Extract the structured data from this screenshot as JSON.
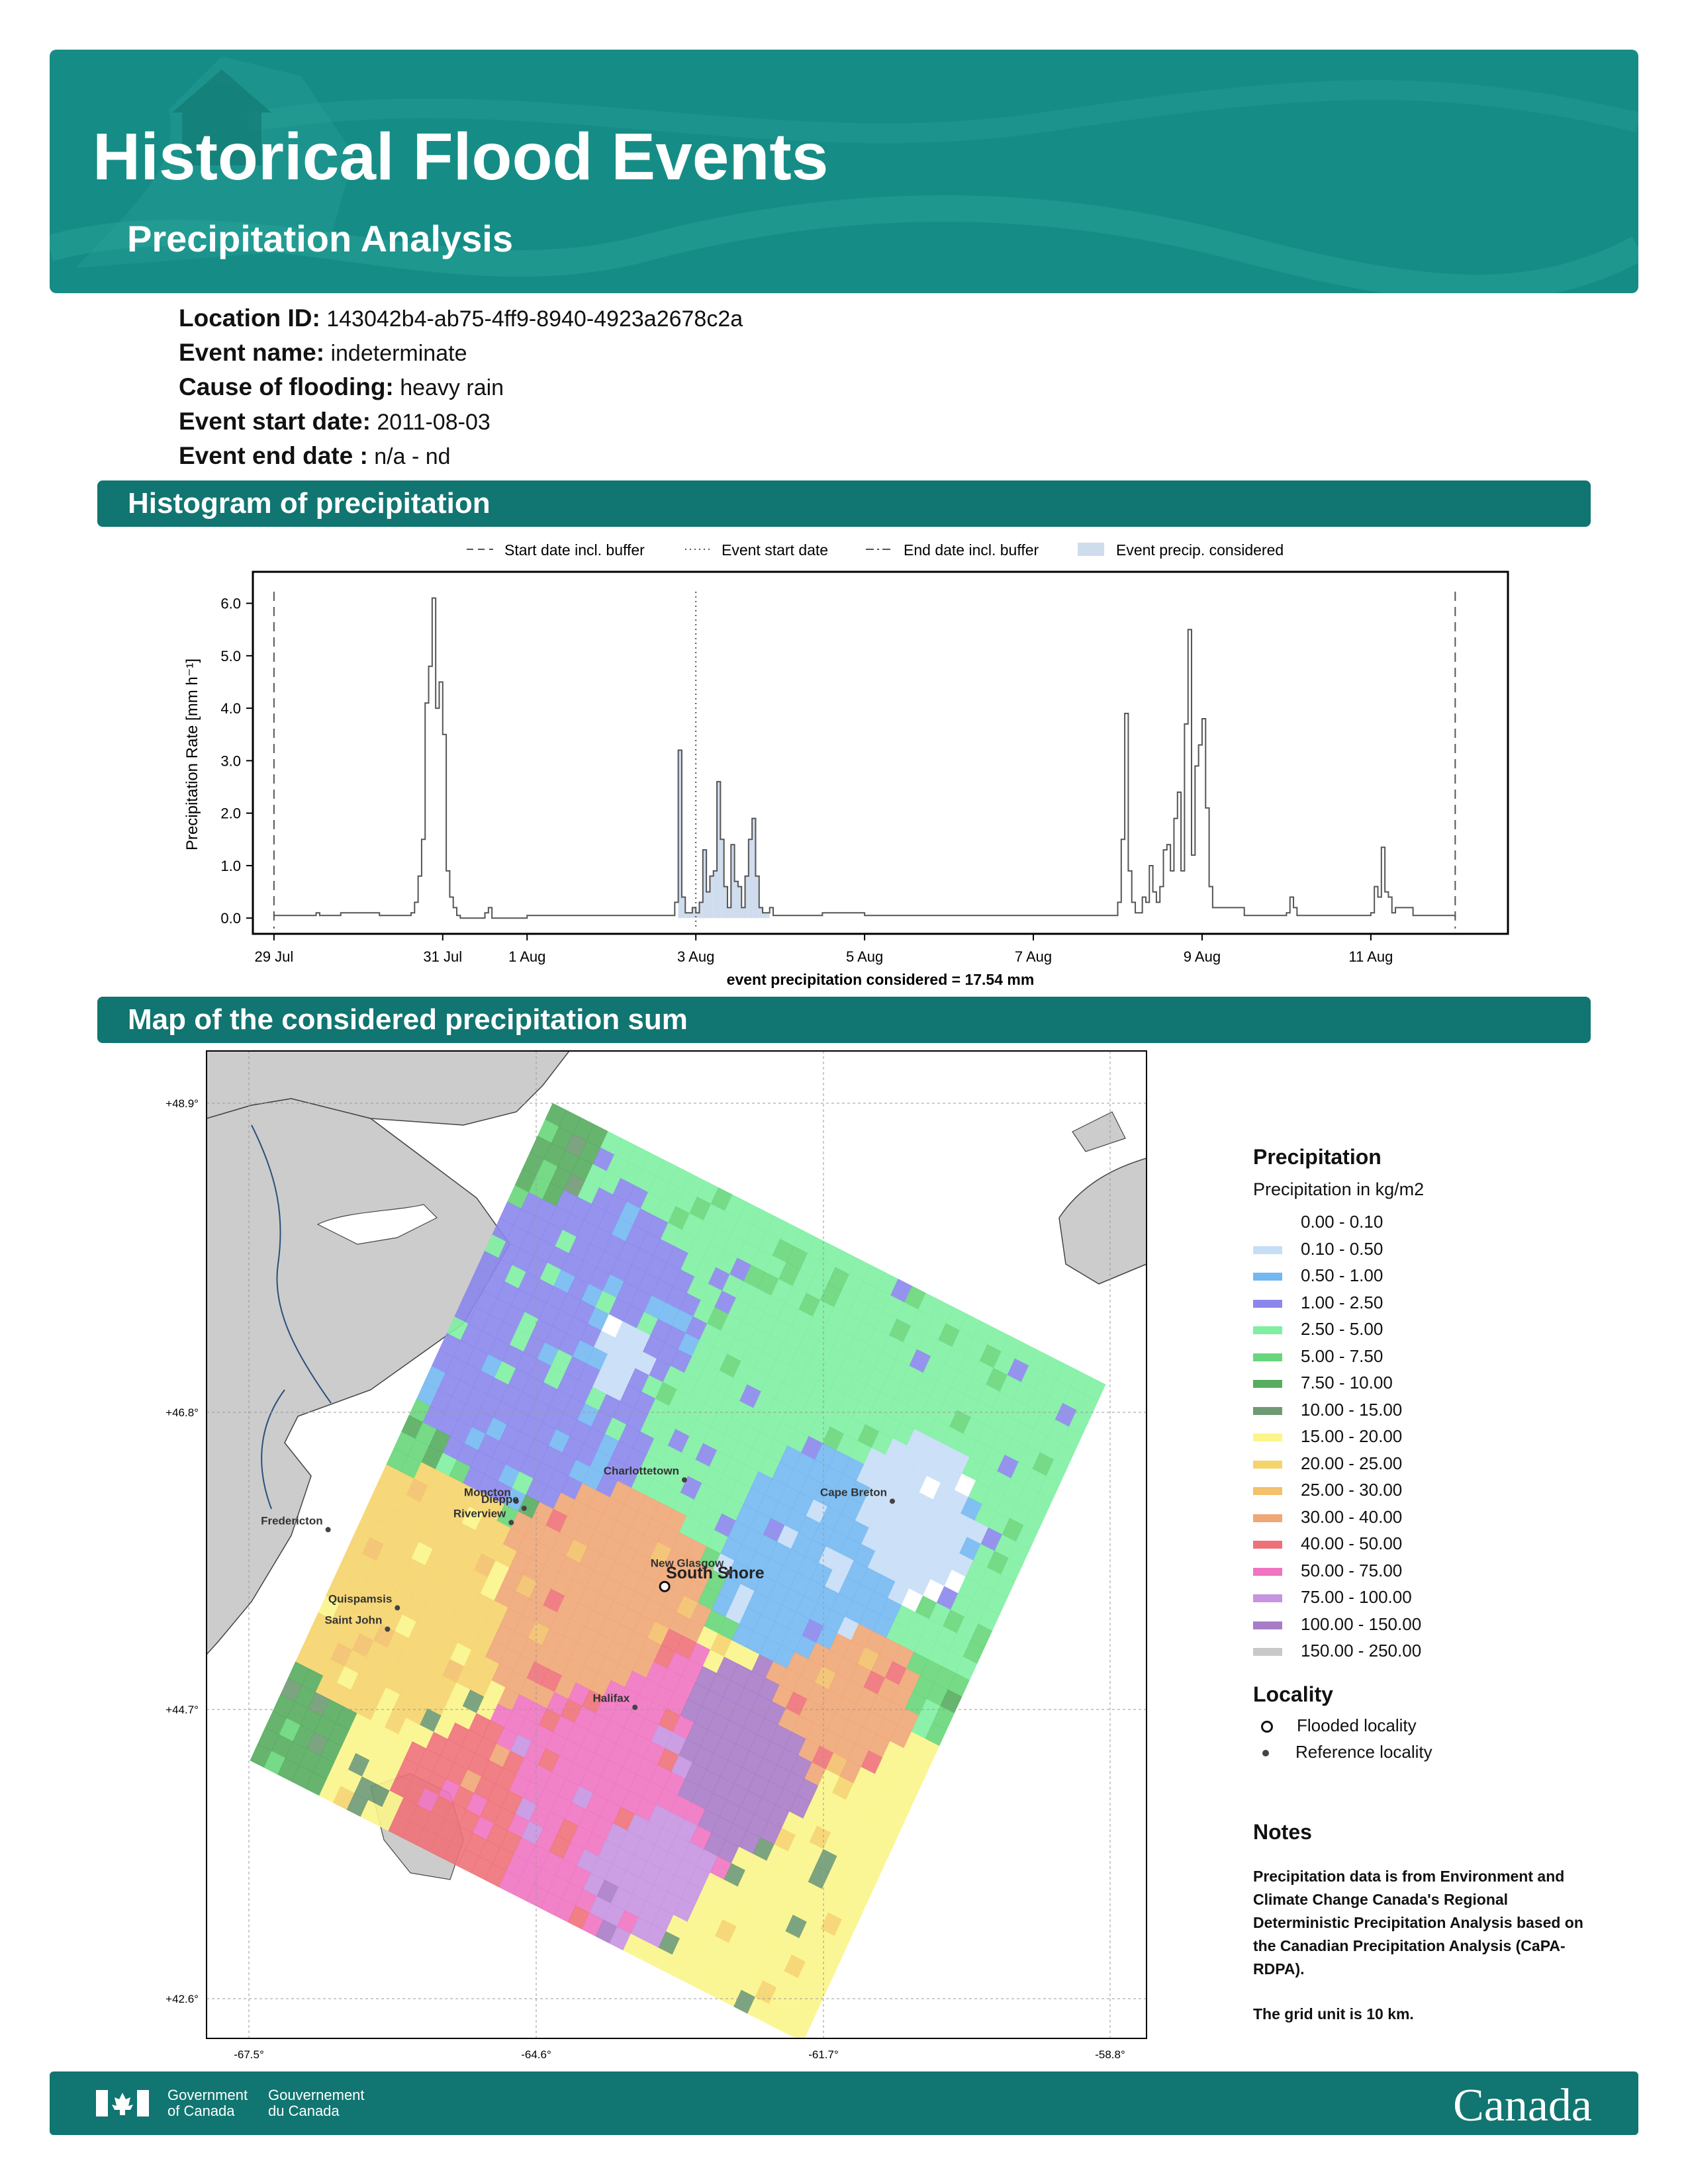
{
  "header": {
    "title": "Historical Flood Events",
    "subtitle": "Precipitation Analysis"
  },
  "info": [
    {
      "label": "Location ID:",
      "value": "143042b4-ab75-4ff9-8940-4923a2678c2a"
    },
    {
      "label": "Event name:",
      "value": "indeterminate"
    },
    {
      "label": "Cause of flooding:",
      "value": "heavy rain"
    },
    {
      "label": "Event start date:",
      "value": "2011-08-03"
    },
    {
      "label": "Event end date :",
      "value": "n/a - nd"
    }
  ],
  "sections": {
    "histogram_title": "Histogram of precipitation",
    "map_title": "Map of the considered precipitation sum"
  },
  "chart_data": [
    {
      "type": "line",
      "title": "",
      "ylabel": "Precipitation Rate [mm h⁻¹]",
      "xlabel": "event precipitation considered = 17.54 mm",
      "ylim": [
        -0.3,
        6.6
      ],
      "xlim": [
        "2011-07-28T18:00",
        "2011-08-12T15:00"
      ],
      "yticks": [
        "0.0",
        "1.0",
        "2.0",
        "3.0",
        "4.0",
        "5.0",
        "6.0"
      ],
      "xticks": [
        {
          "date": "2011-07-29",
          "label": "29 Jul"
        },
        {
          "date": "2011-07-31",
          "label": "31 Jul"
        },
        {
          "date": "2011-08-01",
          "label": "1 Aug"
        },
        {
          "date": "2011-08-03",
          "label": "3 Aug"
        },
        {
          "date": "2011-08-05",
          "label": "5 Aug"
        },
        {
          "date": "2011-08-07",
          "label": "7 Aug"
        },
        {
          "date": "2011-08-09",
          "label": "9 Aug"
        },
        {
          "date": "2011-08-11",
          "label": "11 Aug"
        }
      ],
      "legend": [
        {
          "name": "Start date incl. buffer",
          "style": "dashed"
        },
        {
          "name": "Event start date",
          "style": "dotted"
        },
        {
          "name": "End date incl. buffer",
          "style": "dashdot"
        },
        {
          "name": "Event precip. considered",
          "style": "fill"
        }
      ],
      "legend_position": "top",
      "vlines": {
        "start_buffer": "2011-07-29T00:00",
        "event_start": "2011-08-03T00:00",
        "end_buffer": "2011-08-12T00:00"
      },
      "considered_range": [
        "2011-08-02T19:00",
        "2011-08-03T21:00"
      ],
      "series": [
        {
          "name": "Precipitation Rate",
          "x": [
            "2011-07-29T00:00",
            "2011-07-29T12:00",
            "2011-07-29T13:00",
            "2011-07-29T18:00",
            "2011-07-29T19:00",
            "2011-07-30T06:00",
            "2011-07-30T15:00",
            "2011-07-30T16:00",
            "2011-07-30T17:00",
            "2011-07-30T18:00",
            "2011-07-30T19:00",
            "2011-07-30T20:00",
            "2011-07-30T21:00",
            "2011-07-30T22:00",
            "2011-07-30T23:00",
            "2011-07-31T00:00",
            "2011-07-31T01:00",
            "2011-07-31T02:00",
            "2011-07-31T03:00",
            "2011-07-31T04:00",
            "2011-07-31T05:00",
            "2011-07-31T12:00",
            "2011-07-31T13:00",
            "2011-07-31T14:00",
            "2011-08-01T00:00",
            "2011-08-02T00:00",
            "2011-08-02T18:00",
            "2011-08-02T19:00",
            "2011-08-02T20:00",
            "2011-08-02T21:00",
            "2011-08-02T22:00",
            "2011-08-02T23:00",
            "2011-08-03T00:00",
            "2011-08-03T01:00",
            "2011-08-03T02:00",
            "2011-08-03T03:00",
            "2011-08-03T04:00",
            "2011-08-03T05:00",
            "2011-08-03T06:00",
            "2011-08-03T07:00",
            "2011-08-03T08:00",
            "2011-08-03T09:00",
            "2011-08-03T10:00",
            "2011-08-03T11:00",
            "2011-08-03T12:00",
            "2011-08-03T13:00",
            "2011-08-03T14:00",
            "2011-08-03T15:00",
            "2011-08-03T16:00",
            "2011-08-03T17:00",
            "2011-08-03T18:00",
            "2011-08-03T19:00",
            "2011-08-03T20:00",
            "2011-08-03T21:00",
            "2011-08-03T22:00",
            "2011-08-04T00:00",
            "2011-08-04T12:00",
            "2011-08-05T00:00",
            "2011-08-05T12:00",
            "2011-08-06T00:00",
            "2011-08-06T12:00",
            "2011-08-07T00:00",
            "2011-08-07T12:00",
            "2011-08-07T23:00",
            "2011-08-08T00:00",
            "2011-08-08T01:00",
            "2011-08-08T02:00",
            "2011-08-08T03:00",
            "2011-08-08T04:00",
            "2011-08-08T05:00",
            "2011-08-08T06:00",
            "2011-08-08T07:00",
            "2011-08-08T08:00",
            "2011-08-08T09:00",
            "2011-08-08T10:00",
            "2011-08-08T11:00",
            "2011-08-08T12:00",
            "2011-08-08T13:00",
            "2011-08-08T14:00",
            "2011-08-08T15:00",
            "2011-08-08T16:00",
            "2011-08-08T17:00",
            "2011-08-08T18:00",
            "2011-08-08T19:00",
            "2011-08-08T20:00",
            "2011-08-08T21:00",
            "2011-08-08T22:00",
            "2011-08-08T23:00",
            "2011-08-09T00:00",
            "2011-08-09T01:00",
            "2011-08-09T02:00",
            "2011-08-09T03:00",
            "2011-08-09T06:00",
            "2011-08-09T12:00",
            "2011-08-10T00:00",
            "2011-08-10T01:00",
            "2011-08-10T02:00",
            "2011-08-10T03:00",
            "2011-08-10T12:00",
            "2011-08-11T00:00",
            "2011-08-11T01:00",
            "2011-08-11T02:00",
            "2011-08-11T03:00",
            "2011-08-11T04:00",
            "2011-08-11T05:00",
            "2011-08-11T06:00",
            "2011-08-11T07:00",
            "2011-08-11T12:00",
            "2011-08-12T00:00"
          ],
          "values": [
            0.05,
            0.1,
            0.05,
            0.05,
            0.1,
            0.05,
            0.1,
            0.3,
            0.8,
            1.5,
            4.1,
            4.8,
            6.1,
            4.0,
            4.5,
            3.5,
            0.9,
            0.4,
            0.2,
            0.05,
            0.0,
            0.1,
            0.2,
            0.0,
            0.05,
            0.05,
            0.3,
            3.2,
            0.4,
            0.1,
            0.1,
            0.2,
            0.1,
            0.3,
            1.3,
            0.5,
            0.8,
            0.9,
            2.6,
            1.5,
            0.6,
            0.2,
            1.4,
            0.7,
            0.6,
            0.2,
            0.8,
            1.5,
            1.9,
            0.8,
            0.2,
            0.1,
            0.1,
            0.2,
            0.05,
            0.05,
            0.1,
            0.05,
            0.05,
            0.05,
            0.05,
            0.05,
            0.05,
            0.05,
            0.3,
            1.5,
            3.9,
            0.9,
            0.3,
            0.1,
            0.1,
            0.4,
            0.3,
            1.0,
            0.5,
            0.3,
            0.6,
            1.3,
            1.4,
            0.9,
            1.9,
            2.4,
            0.9,
            3.7,
            5.5,
            1.2,
            2.9,
            3.3,
            3.8,
            2.1,
            0.6,
            0.2,
            0.2,
            0.05,
            0.1,
            0.4,
            0.2,
            0.05,
            0.05,
            0.1,
            0.6,
            0.4,
            1.35,
            0.5,
            0.4,
            0.1,
            0.2,
            0.05,
            0.0
          ]
        }
      ]
    },
    {
      "type": "heatmap",
      "title": "",
      "xticks": [
        "-67.5°",
        "-64.6°",
        "-61.7°",
        "-58.8°"
      ],
      "yticks": [
        "+48.9°",
        "+46.8°",
        "+44.7°",
        "+42.6°"
      ],
      "xlim": [
        -67.5,
        -58.8
      ],
      "ylim": [
        42.6,
        48.9
      ],
      "legend_title": "Precipitation",
      "legend_subtitle": "Precipitation in kg/m2",
      "bins": [
        {
          "label": "0.00 - 0.10",
          "color": "#ffffff"
        },
        {
          "label": "0.10 - 0.50",
          "color": "#c6def6"
        },
        {
          "label": "0.50 - 1.00",
          "color": "#74b8f1"
        },
        {
          "label": "1.00 - 2.50",
          "color": "#8b87ec"
        },
        {
          "label": "2.50 - 5.00",
          "color": "#7fefa2"
        },
        {
          "label": "5.00 - 7.50",
          "color": "#67d67a"
        },
        {
          "label": "7.50 - 10.00",
          "color": "#56ac5f"
        },
        {
          "label": "10.00 - 15.00",
          "color": "#6f9a73"
        },
        {
          "label": "15.00 - 20.00",
          "color": "#fbf58a"
        },
        {
          "label": "20.00 - 25.00",
          "color": "#f5d46b"
        },
        {
          "label": "25.00 - 30.00",
          "color": "#f3c06c"
        },
        {
          "label": "30.00 - 40.00",
          "color": "#f0a677"
        },
        {
          "label": "40.00 - 50.00",
          "color": "#ee7179"
        },
        {
          "label": "50.00 - 75.00",
          "color": "#f074c1"
        },
        {
          "label": "75.00 - 100.00",
          "color": "#c693e1"
        },
        {
          "label": "100.00 - 150.00",
          "color": "#a87cc6"
        },
        {
          "label": "150.00 - 250.00",
          "color": "#c9c9c9"
        }
      ],
      "locality_title": "Locality",
      "localities": [
        {
          "name": "Flooded locality",
          "symbol": "open-circle"
        },
        {
          "name": "Reference locality",
          "symbol": "dot"
        }
      ],
      "places": [
        {
          "name": "South Shore",
          "lon": -63.3,
          "lat": 45.5,
          "type": "flooded"
        },
        {
          "name": "Charlottetown",
          "lon": -63.1,
          "lat": 46.25,
          "type": "reference"
        },
        {
          "name": "Moncton",
          "lon": -64.8,
          "lat": 46.1,
          "type": "reference"
        },
        {
          "name": "Dieppe",
          "lon": -64.72,
          "lat": 46.05,
          "type": "reference"
        },
        {
          "name": "Riverview",
          "lon": -64.85,
          "lat": 45.95,
          "type": "reference"
        },
        {
          "name": "Fredericton",
          "lon": -66.7,
          "lat": 45.9,
          "type": "reference"
        },
        {
          "name": "Quispamsis",
          "lon": -66.0,
          "lat": 45.35,
          "type": "reference"
        },
        {
          "name": "Saint John",
          "lon": -66.1,
          "lat": 45.2,
          "type": "reference"
        },
        {
          "name": "Cape Breton",
          "lon": -61.0,
          "lat": 46.1,
          "type": "reference"
        },
        {
          "name": "New Glasgow",
          "lon": -62.65,
          "lat": 45.6,
          "type": "reference"
        },
        {
          "name": "Halifax",
          "lon": -63.6,
          "lat": 44.65,
          "type": "reference"
        }
      ]
    }
  ],
  "notes": {
    "title": "Notes",
    "text": "Precipitation data is from Environment and Climate Change Canada's Regional Deterministic Precipitation Analysis based on the Canadian Precipitation Analysis (CaPA-RDPA).",
    "grid": "The grid unit is 10 km."
  },
  "footer": {
    "gov_en_1": "Government",
    "gov_en_2": "of Canada",
    "gov_fr_1": "Gouvernement",
    "gov_fr_2": "du Canada",
    "wordmark": "Canada"
  }
}
